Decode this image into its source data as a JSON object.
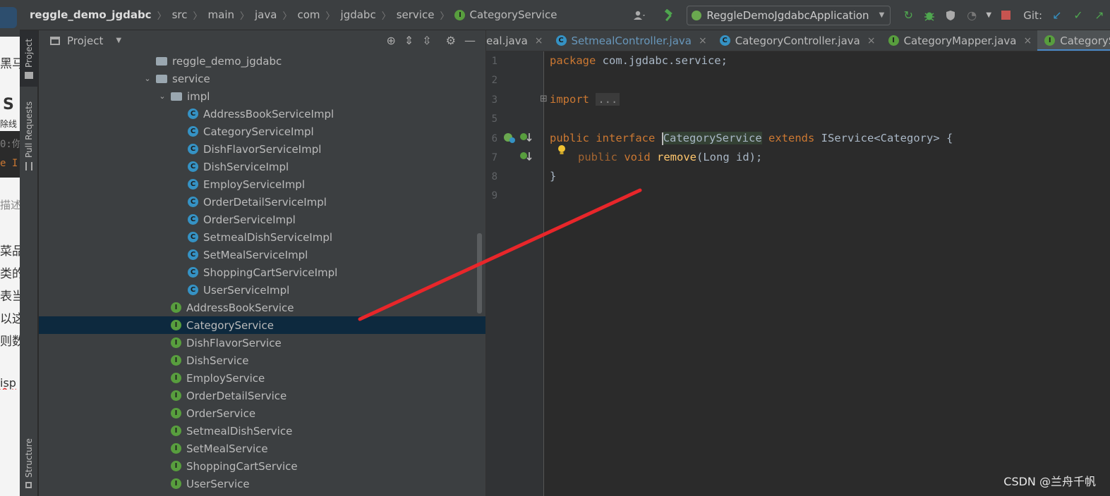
{
  "leaked_left": {
    "chars": [
      "黑马",
      "S",
      "除线",
      "0:你",
      "e I",
      "描述",
      "菜品",
      "类的",
      "表当",
      "以这",
      "则数",
      "isp"
    ]
  },
  "navbar": {
    "crumbs": [
      "reggle_demo_jgdabc",
      "src",
      "main",
      "java",
      "com",
      "jgdabc",
      "service",
      "CategoryService"
    ],
    "run_config": "ReggleDemoJgdabcApplication",
    "git_label": "Git:"
  },
  "tool_stripe": {
    "project": "Project",
    "pull_requests": "Pull Requests",
    "structure": "Structure"
  },
  "project_panel": {
    "title": "Project",
    "tree": [
      {
        "label": "reggle_demo_jgdabc",
        "kind": "package",
        "indent": 0,
        "expanded": null
      },
      {
        "label": "service",
        "kind": "package",
        "indent": 0,
        "expanded": true
      },
      {
        "label": "impl",
        "kind": "package",
        "indent": 1,
        "expanded": true
      },
      {
        "label": "AddressBookServiceImpl",
        "kind": "class",
        "indent": 2
      },
      {
        "label": "CategoryServiceImpl",
        "kind": "class",
        "indent": 2
      },
      {
        "label": "DishFlavorServiceImpl",
        "kind": "class",
        "indent": 2
      },
      {
        "label": "DishServiceImpl",
        "kind": "class",
        "indent": 2
      },
      {
        "label": "EmployServiceImpl",
        "kind": "class",
        "indent": 2
      },
      {
        "label": "OrderDetailServiceImpl",
        "kind": "class",
        "indent": 2
      },
      {
        "label": "OrderServiceImpl",
        "kind": "class",
        "indent": 2
      },
      {
        "label": "SetmealDishServiceImpl",
        "kind": "class",
        "indent": 2
      },
      {
        "label": "SetMealServiceImpl",
        "kind": "class",
        "indent": 2
      },
      {
        "label": "ShoppingCartServiceImpl",
        "kind": "class",
        "indent": 2
      },
      {
        "label": "UserServiceImpl",
        "kind": "class",
        "indent": 2
      },
      {
        "label": "AddressBookService",
        "kind": "interface",
        "indent": 1
      },
      {
        "label": "CategoryService",
        "kind": "interface",
        "indent": 1,
        "selected": true
      },
      {
        "label": "DishFlavorService",
        "kind": "interface",
        "indent": 1
      },
      {
        "label": "DishService",
        "kind": "interface",
        "indent": 1
      },
      {
        "label": "EmployService",
        "kind": "interface",
        "indent": 1
      },
      {
        "label": "OrderDetailService",
        "kind": "interface",
        "indent": 1
      },
      {
        "label": "OrderService",
        "kind": "interface",
        "indent": 1
      },
      {
        "label": "SetmealDishService",
        "kind": "interface",
        "indent": 1
      },
      {
        "label": "SetMealService",
        "kind": "interface",
        "indent": 1
      },
      {
        "label": "ShoppingCartService",
        "kind": "interface",
        "indent": 1
      },
      {
        "label": "UserService",
        "kind": "interface",
        "indent": 1
      }
    ]
  },
  "editor": {
    "tabs": [
      {
        "label": "eal.java",
        "icon": "",
        "modified": false,
        "active": false
      },
      {
        "label": "SetmealController.java",
        "icon": "C",
        "modified": true,
        "active": false
      },
      {
        "label": "CategoryController.java",
        "icon": "C",
        "modified": false,
        "active": false
      },
      {
        "label": "CategoryMapper.java",
        "icon": "I",
        "modified": false,
        "active": false
      },
      {
        "label": "CategorySe",
        "icon": "I",
        "modified": false,
        "active": true
      }
    ],
    "line_numbers": [
      "1",
      "2",
      "3",
      "5",
      "6",
      "7",
      "8",
      "9"
    ],
    "code": {
      "l1_kw": "package",
      "l1_rest": " com.jgdabc.service;",
      "l3_kw": "import",
      "l3_fold": "...",
      "l6_kw1": "public",
      "l6_kw2": "interface",
      "l6_name": "CategoryService",
      "l6_kw3": "extends",
      "l6_rest": " IService<Category> {",
      "l7_kw1": "public",
      "l7_kw2": "void",
      "l7_fn": "remove",
      "l7_rest": "(Long id);",
      "l8": "}"
    }
  },
  "watermark": "CSDN @兰舟千帆",
  "colors": {
    "annotation": "#e8262a",
    "selection": "#0d293e",
    "keyword": "#cc7832",
    "class_icon": "#3592c4",
    "interface_icon": "#589e3e"
  }
}
